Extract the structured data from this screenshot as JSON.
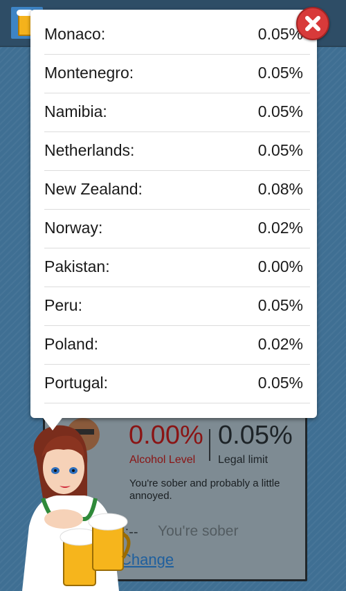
{
  "app": {
    "icon": "beer-mug-icon"
  },
  "popup": {
    "rows": [
      {
        "country": "Monaco:",
        "limit": "0.05%"
      },
      {
        "country": "Montenegro:",
        "limit": "0.05%"
      },
      {
        "country": "Namibia:",
        "limit": "0.05%"
      },
      {
        "country": "Netherlands:",
        "limit": "0.05%"
      },
      {
        "country": "New Zealand:",
        "limit": "0.08%"
      },
      {
        "country": "Norway:",
        "limit": "0.02%"
      },
      {
        "country": "Pakistan:",
        "limit": "0.00%"
      },
      {
        "country": "Peru:",
        "limit": "0.05%"
      },
      {
        "country": "Poland:",
        "limit": "0.02%"
      },
      {
        "country": "Portugal:",
        "limit": "0.05%"
      }
    ],
    "close_icon": "close-x-icon"
  },
  "info": {
    "alcohol_level_value": "0.00%",
    "alcohol_level_caption": "Alcohol Level",
    "legal_limit_value": "0.05%",
    "legal_limit_caption": "Legal limit",
    "status_message": "You're sober and probably a little annoyed.",
    "time_value": "-:--",
    "sober_label": "You're sober",
    "change_label": "Change"
  },
  "colors": {
    "alcohol": "#8a1414",
    "close_button": "#d83a3a",
    "link": "#1e5f9e"
  }
}
